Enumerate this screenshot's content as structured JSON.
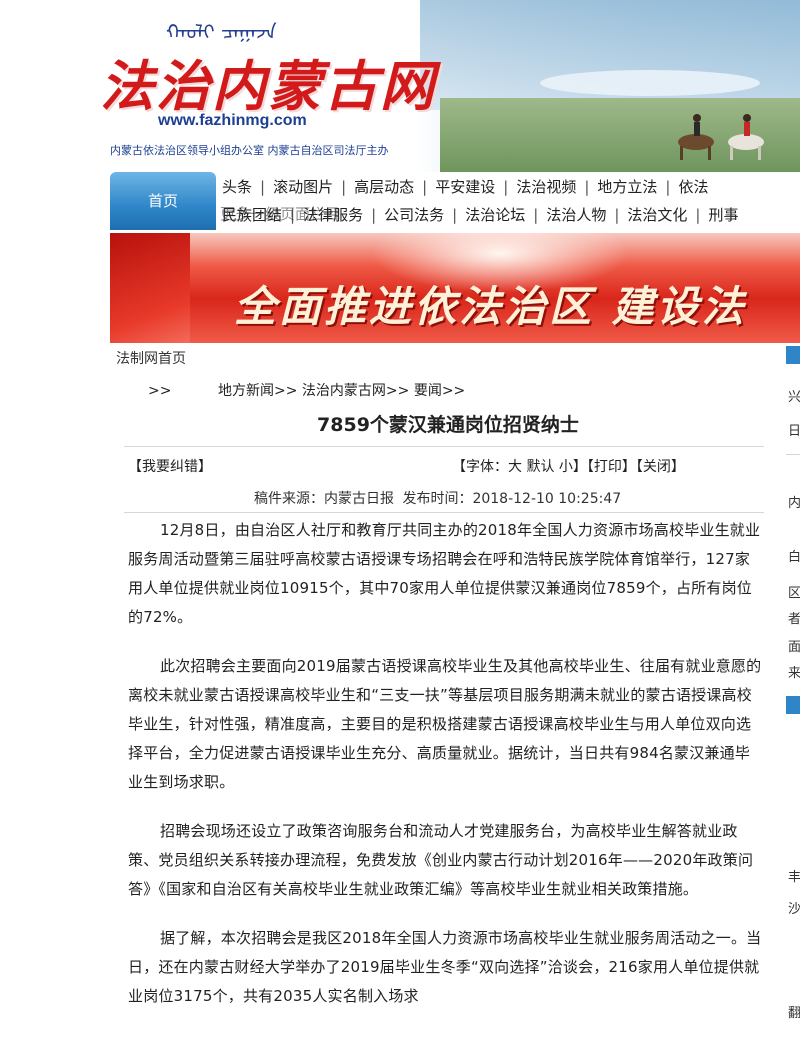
{
  "header": {
    "mongolian_script": "ᠬᠠᠤᠯᠢ ᠴᠠᠭᠠᠵᠠ",
    "logo_text": "法治内蒙古网",
    "site_url": "www.fazhinmg.com",
    "organization": "内蒙古依法治区领导小组办公室 内蒙古自治区司法厅主办"
  },
  "nav": {
    "home": "首页",
    "row1": [
      "头条",
      "滚动图片",
      "高层动态",
      "平安建设",
      "法治视频",
      "地方立法",
      "依法"
    ],
    "row2": [
      "民族团结",
      "法律服务",
      "公司法务",
      "法治论坛",
      "法治人物",
      "法治文化",
      "刑事"
    ],
    "overlap_text": "更多一级页面栏目"
  },
  "banner": {
    "slogan": "全面推进依法治区 建设法"
  },
  "article": {
    "site_home": "法制网首页",
    "breadcrumb_lead": ">>",
    "breadcrumb": "地方新闻>> 法治内蒙古网>> 要闻>>",
    "title": "7859个蒙汉兼通岗位招贤纳士",
    "report_error": "【我要纠错】",
    "font_label": "【字体：",
    "font_large": "大",
    "font_default": "默认",
    "font_small": "小】",
    "print": "【打印】",
    "close": "【关闭】",
    "source": "稿件来源：内蒙古日报",
    "publish_time": "发布时间：2018-12-10 10:25:47",
    "paragraphs": [
      "12月8日，由自治区人社厅和教育厅共同主办的2018年全国人力资源市场高校毕业生就业服务周活动暨第三届驻呼高校蒙古语授课专场招聘会在呼和浩特民族学院体育馆举行，127家用人单位提供就业岗位10915个，其中70家用人单位提供蒙汉兼通岗位7859个，占所有岗位的72%。",
      "此次招聘会主要面向2019届蒙古语授课高校毕业生及其他高校毕业生、往届有就业意愿的离校未就业蒙古语授课高校毕业生和“三支一扶”等基层项目服务期满未就业的蒙古语授课高校毕业生，针对性强，精准度高，主要目的是积极搭建蒙古语授课高校毕业生与用人单位双向选择平台，全力促进蒙古语授课毕业生充分、高质量就业。据统计，当日共有984名蒙汉兼通毕业生到场求职。",
      "招聘会现场还设立了政策咨询服务台和流动人才党建服务台，为高校毕业生解答就业政策、党员组织关系转接办理流程，免费发放《创业内蒙古行动计划2016年——2020年政策问答》《国家和自治区有关高校毕业生就业政策汇编》等高校毕业生就业相关政策措施。",
      "据了解，本次招聘会是我区2018年全国人力资源市场高校毕业生就业服务周活动之一。当日，还在内蒙古财经大学举办了2019届毕业生冬季“双向选择”洽谈会，216家用人单位提供就业岗位3175个，共有2035人实名制入场求"
    ]
  },
  "sidebar": {
    "chars": [
      "兴",
      "日",
      "内",
      "白",
      "区",
      "者",
      "面",
      "来",
      "丰",
      "沙",
      "翻"
    ]
  }
}
